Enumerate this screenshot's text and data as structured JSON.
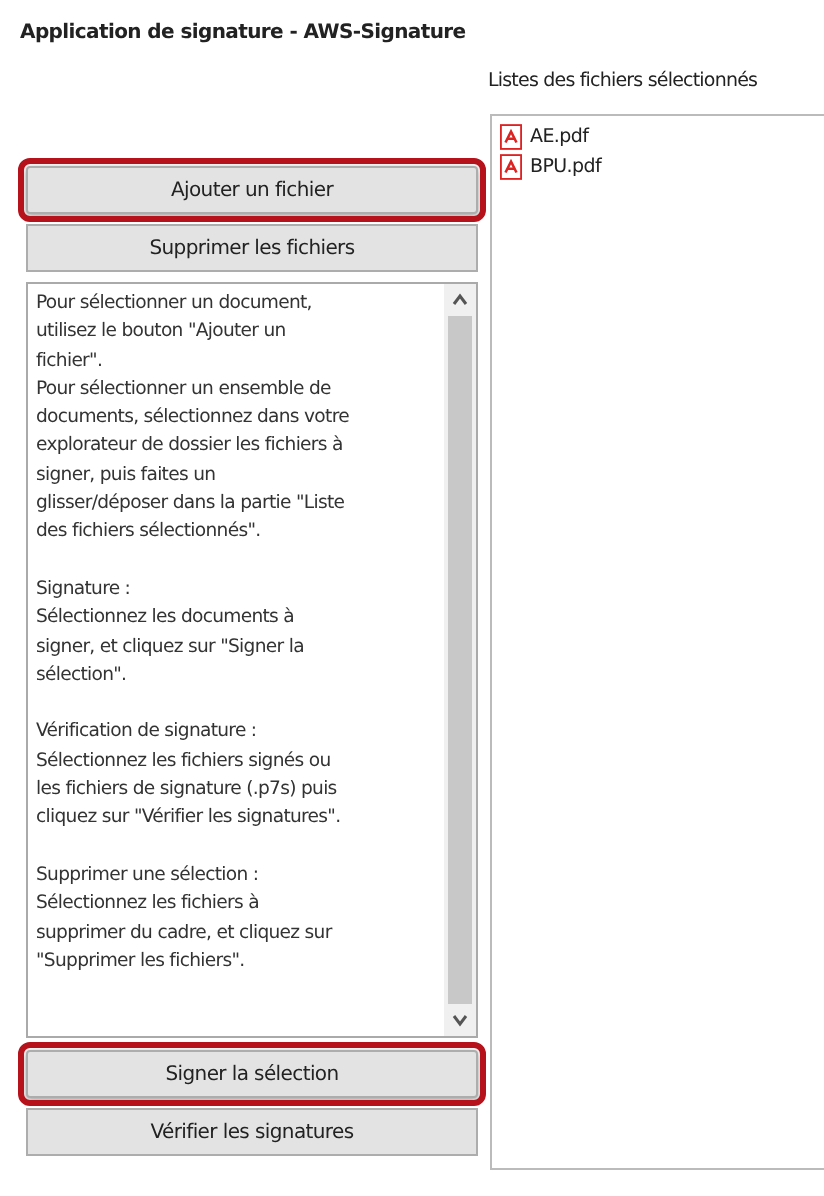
{
  "window": {
    "title": "Application de signature - AWS-Signature"
  },
  "file_list": {
    "label": "Listes des fichiers sélectionnés",
    "files": [
      {
        "name": "AE.pdf"
      },
      {
        "name": "BPU.pdf"
      }
    ]
  },
  "top_buttons": [
    {
      "label": "Ajouter un fichier",
      "highlighted": true
    },
    {
      "label": "Supprimer les fichiers",
      "highlighted": false
    }
  ],
  "help_paragraphs": [
    [
      "Pour sélectionner un document,",
      "utilisez le bouton \"Ajouter un",
      "fichier\".",
      "Pour sélectionner un ensemble de",
      "documents, sélectionnez dans votre",
      "explorateur de dossier les fichiers à",
      "signer, puis faites un",
      "glisser/déposer dans la partie \"Liste",
      "des fichiers sélectionnés\"."
    ],
    [
      "Signature :",
      "Sélectionnez les documents à",
      "signer, et cliquez sur \"Signer la",
      "sélection\"."
    ],
    [
      "Vérification de signature :",
      "Sélectionnez les fichiers signés ou",
      "les fichiers de signature (.p7s) puis",
      "cliquez sur \"Vérifier les signatures\"."
    ],
    [
      "Supprimer une sélection :",
      "Sélectionnez les fichiers à",
      "supprimer du cadre, et cliquez sur",
      "\"Supprimer les fichiers\"."
    ]
  ],
  "bottom_buttons": [
    {
      "label": "Signer la sélection",
      "highlighted": true
    },
    {
      "label": "Vérifier les signatures",
      "highlighted": false
    }
  ]
}
